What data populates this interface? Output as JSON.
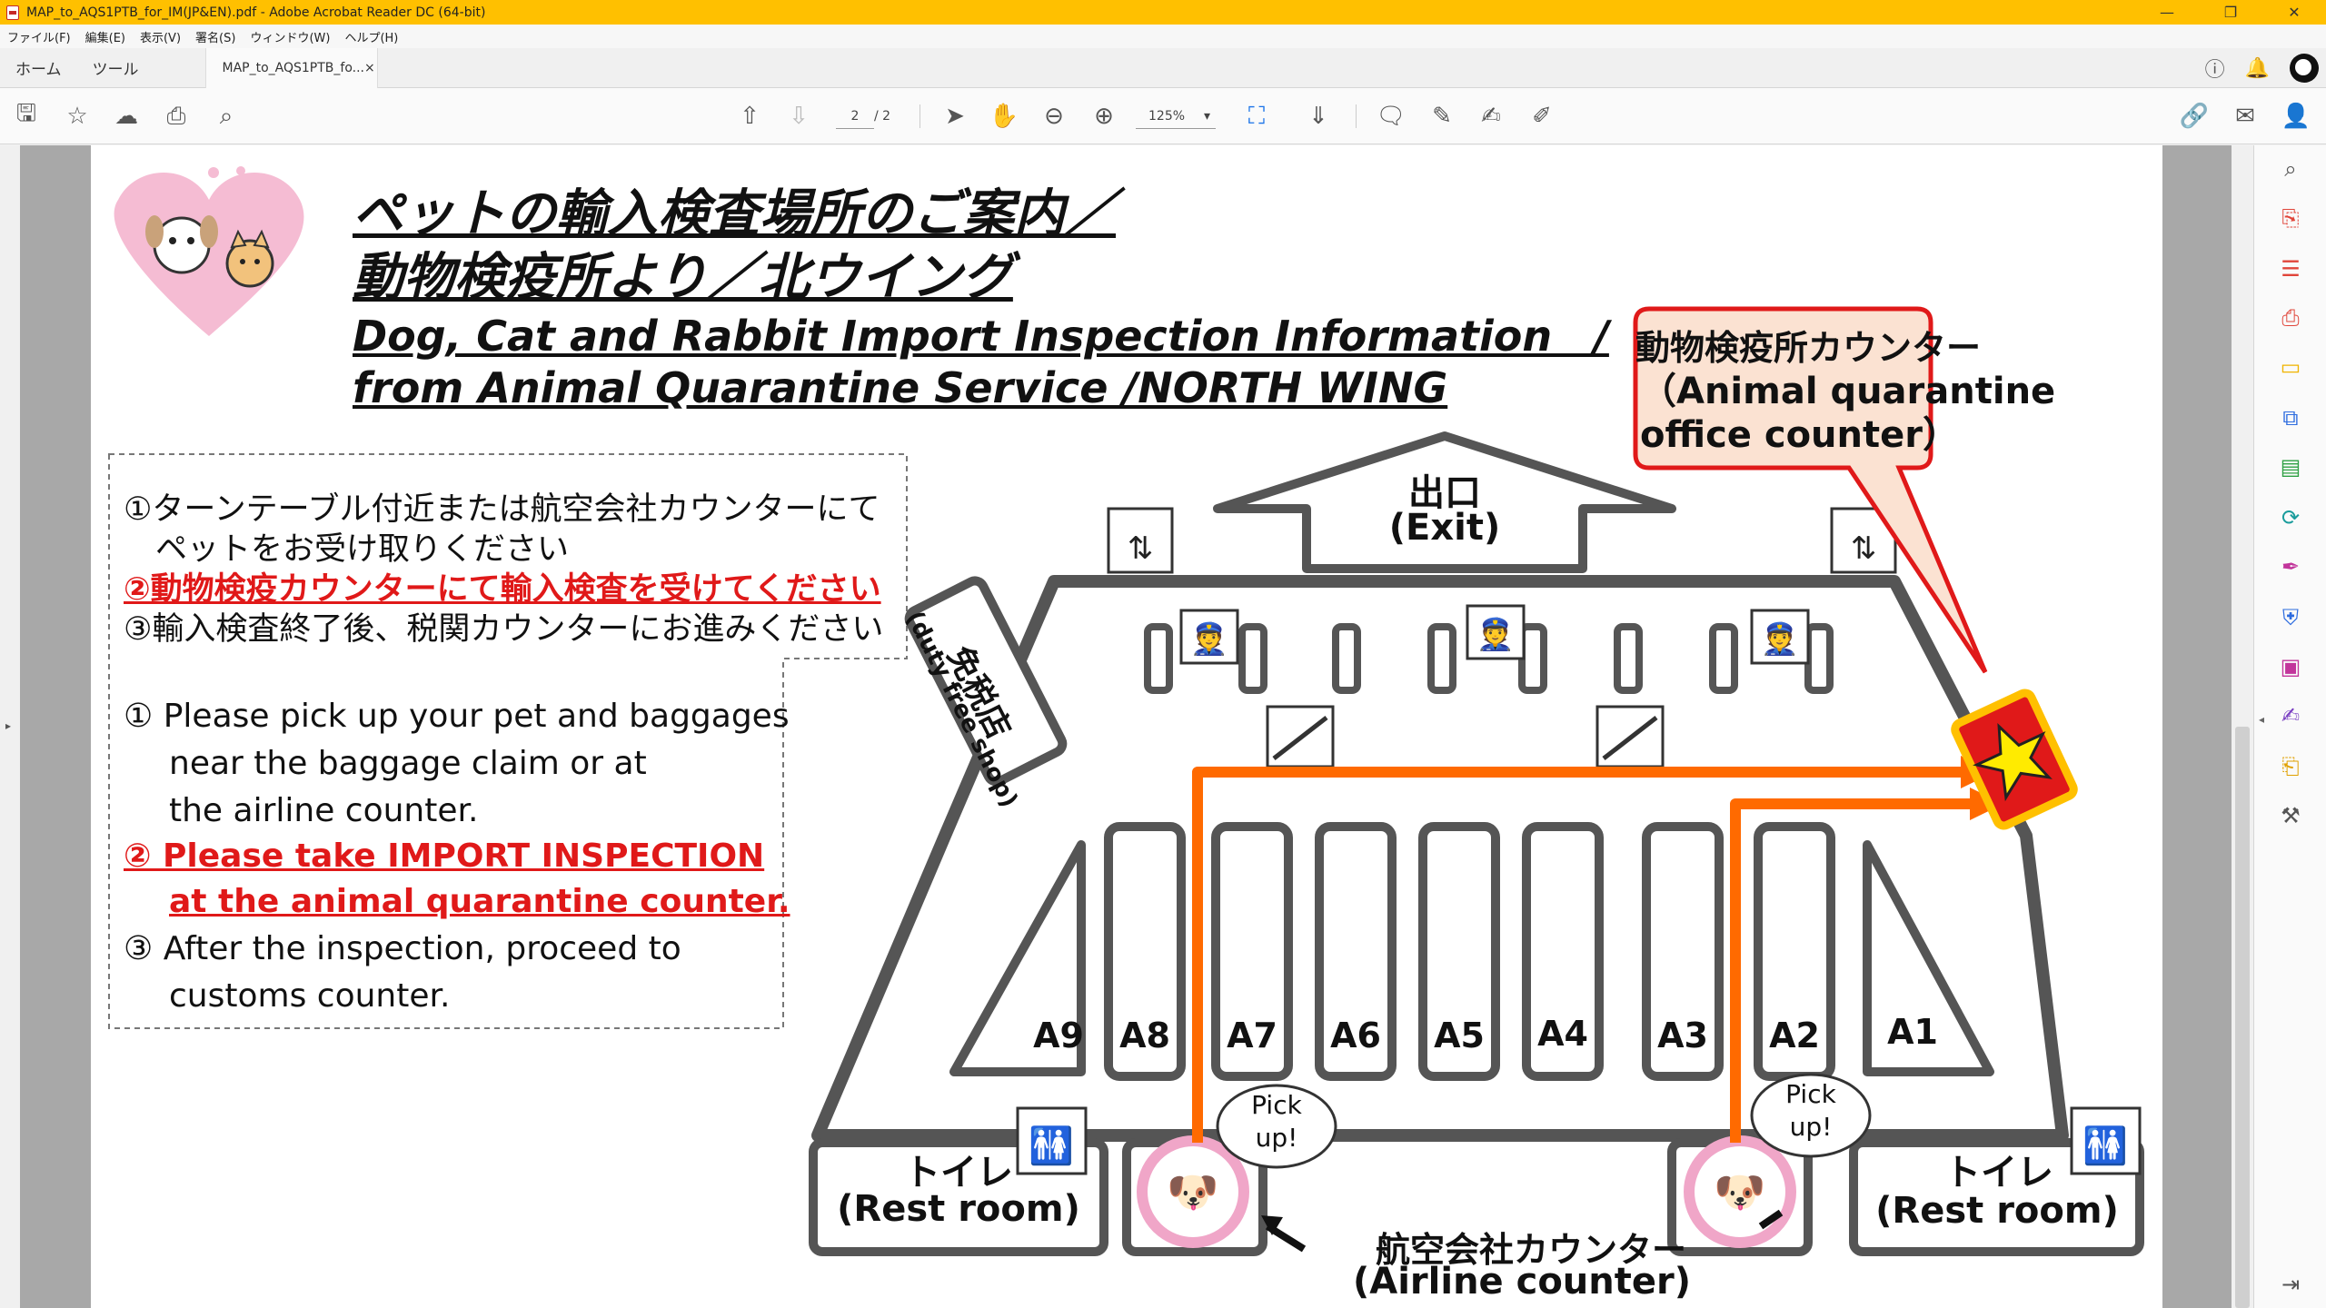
{
  "window": {
    "title": "MAP_to_AQS1PTB_for_IM(JP&EN).pdf - Adobe Acrobat Reader DC (64-bit)"
  },
  "menu": [
    "ファイル(F)",
    "編集(E)",
    "表示(V)",
    "署名(S)",
    "ウィンドウ(W)",
    "ヘルプ(H)"
  ],
  "tabs": {
    "home": "ホーム",
    "tools": "ツール",
    "document": "MAP_to_AQS1PTB_fo...",
    "close": "×"
  },
  "toolbar": {
    "page_current": "2",
    "page_total": "/ 2",
    "zoom": "125%"
  },
  "document": {
    "title_jp_line1": "ペットの輸入検査場所のご案内／",
    "title_jp_line2": "動物検疫所より／北ウイング",
    "title_en_line1": "Dog, Cat and Rabbit Import Inspection Information　/",
    "title_en_line2": "from Animal Quarantine Service /NORTH WING",
    "jp_steps": [
      "①ターンテーブル付近または航空会社カウンターにて",
      "　ペットをお受け取りください",
      "②動物検疫カウンターにて輸入検査を受けてください",
      "③輸入検査終了後、税関カウンターにお進みください"
    ],
    "en_steps": [
      "① Please pick up your pet  and baggages",
      "near the baggage claim or at",
      "the airline counter.",
      "② Please take IMPORT INSPECTION",
      "at the animal quarantine counter.",
      "③ After the inspection, proceed to",
      "customs counter."
    ],
    "map": {
      "exit_jp": "出口",
      "exit_en": "(Exit)",
      "duty_free_jp": "免税店",
      "duty_free_en": "(duty free shop)",
      "counter_callout_jp": "動物検疫所カウンター",
      "counter_callout_en1": "（Animal quarantine",
      "counter_callout_en2": "office counter）",
      "carousels": [
        "A9",
        "A8",
        "A7",
        "A6",
        "A5",
        "A4",
        "A3",
        "A2",
        "A1"
      ],
      "restroom_jp": "トイレ",
      "restroom_en": "(Rest room)",
      "pickup_line1": "Pick",
      "pickup_line2": "up!",
      "airline_jp": "航空会社カウンター",
      "airline_en": "(Airline counter)"
    }
  }
}
